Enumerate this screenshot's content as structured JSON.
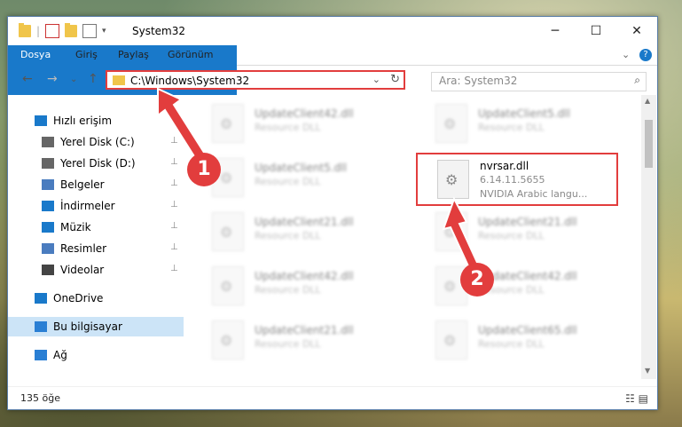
{
  "window": {
    "title": "System32",
    "controls": {
      "minimize": "─",
      "maximize": "☐",
      "close": "✕"
    }
  },
  "ribbon": {
    "tabs": [
      "Dosya",
      "Giriş",
      "Paylaş",
      "Görünüm"
    ],
    "expand_icon": "⌄",
    "help_icon": "?"
  },
  "nav": {
    "back": "←",
    "forward": "→",
    "recent": "⌄",
    "up": "↑",
    "address": "C:\\Windows\\System32",
    "address_dropdown": "⌄",
    "refresh": "↻",
    "search_placeholder": "Ara: System32",
    "search_icon": "⌕"
  },
  "sidebar": {
    "items": [
      {
        "label": "Hızlı erişim",
        "icon": "star-icon",
        "pinned": false
      },
      {
        "label": "Yerel Disk (C:)",
        "icon": "drive-icon",
        "pinned": true
      },
      {
        "label": "Yerel Disk (D:)",
        "icon": "drive-icon",
        "pinned": true
      },
      {
        "label": "Belgeler",
        "icon": "documents-icon",
        "pinned": true
      },
      {
        "label": "İndirmeler",
        "icon": "download-icon",
        "pinned": true
      },
      {
        "label": "Müzik",
        "icon": "music-icon",
        "pinned": true
      },
      {
        "label": "Resimler",
        "icon": "pictures-icon",
        "pinned": true
      },
      {
        "label": "Videolar",
        "icon": "videos-icon",
        "pinned": true
      },
      {
        "label": "OneDrive",
        "icon": "cloud-icon",
        "pinned": false
      },
      {
        "label": "Bu bilgisayar",
        "icon": "computer-icon",
        "pinned": false,
        "selected": true
      },
      {
        "label": "Ağ",
        "icon": "network-icon",
        "pinned": false
      }
    ],
    "pin_glyph": "📌"
  },
  "files": [
    {
      "name": "UpdateClient42.dll",
      "desc": "Resource DLL",
      "blurred": true
    },
    {
      "name": "UpdateClient5.dll",
      "desc": "Resource DLL",
      "blurred": true
    },
    {
      "name": "UpdateClient5.dll",
      "desc": "Resource DLL",
      "blurred": true
    },
    {
      "name": "nvrsar.dll",
      "version": "6.14.11.5655",
      "desc": "NVIDIA Arabic langu...",
      "blurred": false,
      "highlighted": true
    },
    {
      "name": "UpdateClient21.dll",
      "desc": "Resource DLL",
      "blurred": true
    },
    {
      "name": "UpdateClient21.dll",
      "desc": "Resource DLL",
      "blurred": true
    },
    {
      "name": "UpdateClient42.dll",
      "desc": "Resource DLL",
      "blurred": true
    },
    {
      "name": "UpdateClient42.dll",
      "desc": "Resource DLL",
      "blurred": true
    },
    {
      "name": "UpdateClient21.dll",
      "desc": "Resource DLL",
      "blurred": true
    },
    {
      "name": "UpdateClient65.dll",
      "desc": "Resource DLL",
      "blurred": true
    }
  ],
  "status": {
    "count": "135 öğe",
    "view_icons": "☷ ▤"
  },
  "annotations": {
    "step1": "1",
    "step2": "2",
    "color": "#e23d3d"
  },
  "colors": {
    "accent": "#1979ca",
    "highlight": "#e23d3d",
    "selected": "#cce4f7"
  }
}
